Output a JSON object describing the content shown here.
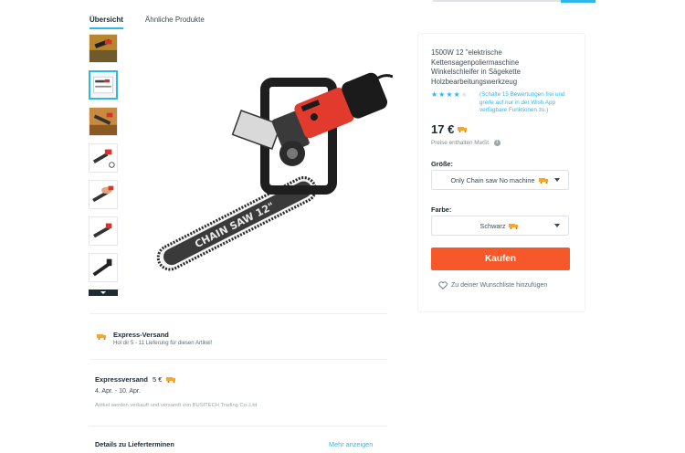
{
  "tabs": [
    {
      "label": "Übersicht",
      "active": true
    },
    {
      "label": "Ähnliche Produkte",
      "active": false
    }
  ],
  "product": {
    "title": "1500W 12 \"elektrische Kettensagenpoliermaschine Winkelschleifer in Sägekette Holzbearbeitungswerkzeug",
    "rating_stars": 3.5,
    "rating_note": "(Schalte 15 Bewertungen frei und greife auf nur in der Wish App verfügbare Funktionen zu.)",
    "price": "17 €",
    "tax_note": "Preise enthalten MwSt.",
    "image_label": "CHAIN SAW 12\""
  },
  "options": {
    "size_label": "Größe:",
    "size_value": "Only Chain saw No machine",
    "color_label": "Farbe:",
    "color_value": "Schwarz"
  },
  "actions": {
    "buy_label": "Kaufen",
    "wishlist_label": "Zu deiner Wunschliste hinzufügen"
  },
  "shipping": {
    "express_title": "Express-Versand",
    "express_sub": "Hol dir 5 - 11 Lieferung für diesen Artikel!",
    "method_label": "Expressversand",
    "method_price": "5 €",
    "dates": "4. Apr. - 10. Apr.",
    "seller_note": "Artikel werden verkauft und versandt von BUSITECH Trading Co.,Ltd",
    "details_label": "Details zu Lieferterminen",
    "more_label": "Mehr anzeigen"
  },
  "colors": {
    "accent": "#2fb7ec",
    "buy": "#f6582a",
    "truck": "#f7a62a"
  },
  "icons": [
    "info-icon",
    "truck-icon",
    "heart-icon",
    "chevron-down-icon",
    "star-icon"
  ]
}
